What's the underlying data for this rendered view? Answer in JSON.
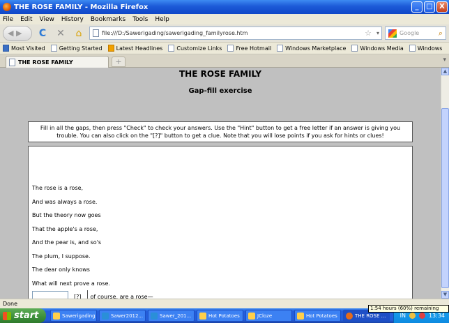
{
  "window": {
    "title": "THE ROSE FAMILY - Mozilla Firefox",
    "minimize": "_",
    "maximize": "□",
    "close": "X"
  },
  "menu": [
    "File",
    "Edit",
    "View",
    "History",
    "Bookmarks",
    "Tools",
    "Help"
  ],
  "nav": {
    "url": "file:///D:/Sawerigading/sawerigading_familyrose.htm",
    "search_placeholder": "Google"
  },
  "bookmarks": [
    "Most Visited",
    "Getting Started",
    "Latest Headlines",
    "Customize Links",
    "Free Hotmail",
    "Windows Marketplace",
    "Windows Media",
    "Windows"
  ],
  "tab": {
    "title": "THE ROSE FAMILY",
    "new_tab": "+"
  },
  "page": {
    "title": "THE ROSE FAMILY",
    "subtitle": "Gap-fill exercise",
    "instructions": "Fill in all the gaps, then press \"Check\" to check your answers. Use the \"Hint\" button to get a free letter if an answer is giving you trouble. You can also click on the \"[?]\" button to get a clue. Note that you will lose points if you ask for hints or clues!",
    "poem_lines": [
      "The rose is a rose,",
      "And was always a rose.",
      "But the theory now goes",
      "That the apple's a rose,",
      "And the pear is, and so's",
      "The plum, I suppose.",
      "The dear only knows",
      "What will next prove a rose."
    ],
    "clue_button": "[?]",
    "gap_text": "of course, are a rose—"
  },
  "status": {
    "text": "Done",
    "battery": "1:54 hours (60%) remaining"
  },
  "taskbar": {
    "start": "start",
    "tasks": [
      {
        "label": "Sawerigading",
        "icon": "folder-icon"
      },
      {
        "label": "Sawer2012...",
        "icon": "document-icon"
      },
      {
        "label": "Sawer_201...",
        "icon": "document-icon"
      },
      {
        "label": "Hot Potatoes",
        "icon": "hot-potatoes-icon"
      },
      {
        "label": "JCloze",
        "icon": "hot-potatoes-icon"
      },
      {
        "label": "Hot Potatoes",
        "icon": "hot-potatoes-icon"
      },
      {
        "label": "THE ROSE ...",
        "icon": "firefox-icon"
      }
    ],
    "lang": "IN",
    "time": "13:34"
  }
}
